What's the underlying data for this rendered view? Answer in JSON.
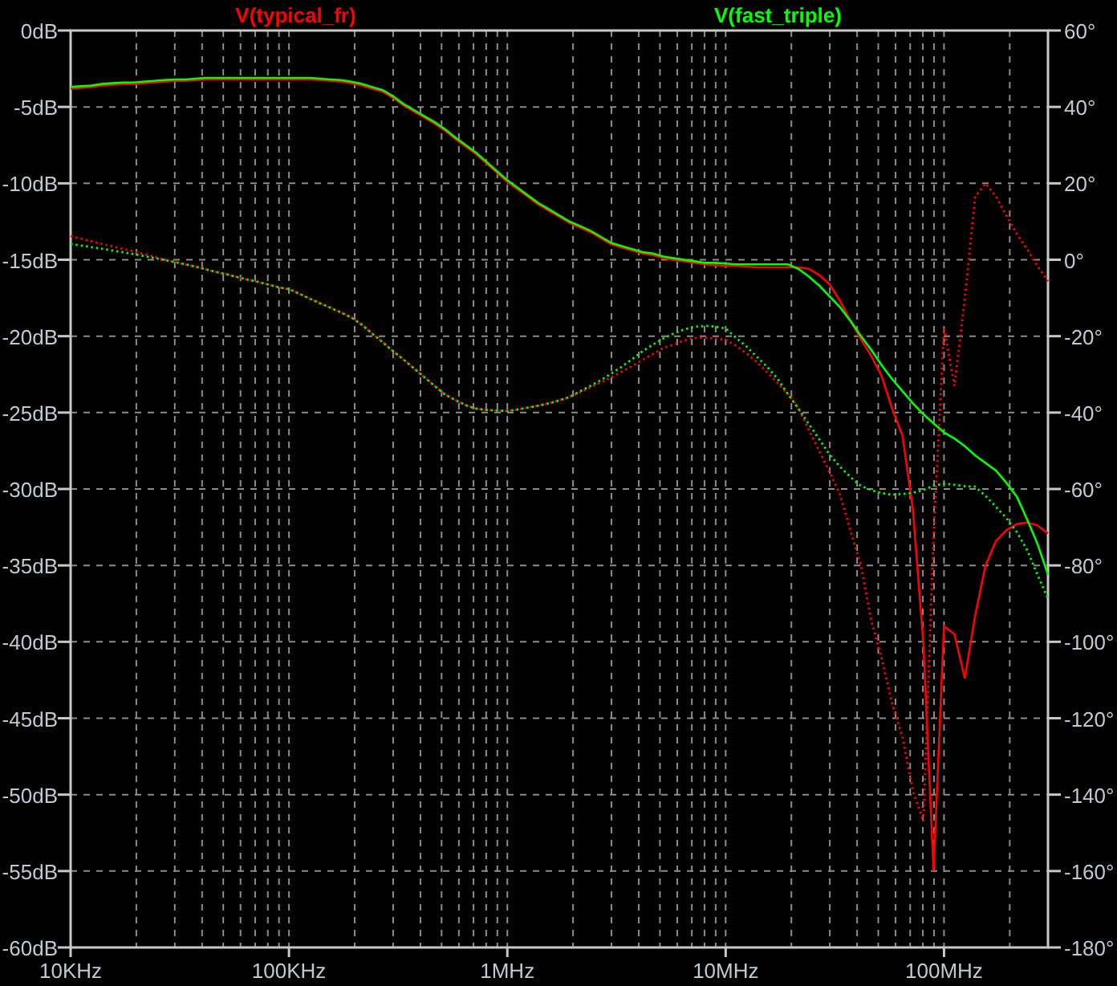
{
  "plot": {
    "magnitude": {
      "chart_data": {
        "type": "line",
        "grid": true,
        "categories": [
          "10KHz",
          null,
          null,
          null,
          null,
          null,
          null,
          null,
          null,
          null,
          null,
          null,
          null,
          null,
          null,
          null,
          null,
          null,
          null,
          null,
          null,
          "100KHz",
          null,
          null,
          null,
          null,
          null,
          null,
          null,
          null,
          null,
          null,
          null,
          null,
          null,
          null,
          null,
          null,
          null,
          null,
          null,
          null,
          "1MHz",
          null,
          null,
          null,
          null,
          null,
          null,
          null,
          null,
          null,
          null,
          null,
          null,
          null,
          null,
          null,
          null,
          null,
          null,
          null,
          null,
          "10MHz",
          null,
          null,
          null,
          null,
          null,
          null,
          null,
          null,
          null,
          null,
          null,
          null,
          null,
          null,
          null,
          null,
          null,
          null,
          null,
          null,
          "100MHz",
          null,
          null,
          null,
          null,
          null,
          null,
          null,
          null,
          null,
          null
        ],
        "ylim": [
          -60,
          0
        ],
        "yticks": [
          {
            "value": 0,
            "label": "0dB"
          },
          {
            "value": -5,
            "label": "-5dB"
          },
          {
            "value": -10,
            "label": "-10dB"
          },
          {
            "value": -15,
            "label": "-15dB"
          },
          {
            "value": -20,
            "label": "-20dB"
          },
          {
            "value": -25,
            "label": "-25dB"
          },
          {
            "value": -30,
            "label": "-30dB"
          },
          {
            "value": -35,
            "label": "-35dB"
          },
          {
            "value": -40,
            "label": "-40dB"
          },
          {
            "value": -45,
            "label": "-45dB"
          },
          {
            "value": -50,
            "label": "-50dB"
          },
          {
            "value": -55,
            "label": "-55dB"
          },
          {
            "value": -60,
            "label": "-60dB"
          }
        ],
        "series": [
          {
            "name": "V(typical_fr)",
            "color": "#ff0000",
            "line_style": "solid",
            "values": [
              -3.8,
              -3.75,
              -3.7,
              -3.6,
              -3.55,
              -3.5,
              -3.5,
              -3.45,
              -3.4,
              -3.35,
              -3.3,
              -3.3,
              -3.25,
              -3.2,
              -3.2,
              -3.2,
              -3.2,
              -3.2,
              -3.2,
              -3.2,
              -3.2,
              -3.2,
              -3.2,
              -3.2,
              -3.25,
              -3.3,
              -3.35,
              -3.45,
              -3.6,
              -3.8,
              -4.0,
              -4.4,
              -4.9,
              -5.3,
              -5.7,
              -6.1,
              -6.55,
              -7.1,
              -7.6,
              -8.1,
              -8.7,
              -9.3,
              -9.9,
              -10.4,
              -10.9,
              -11.4,
              -11.8,
              -12.2,
              -12.6,
              -12.9,
              -13.2,
              -13.6,
              -14.0,
              -14.2,
              -14.4,
              -14.6,
              -14.7,
              -14.9,
              -15.0,
              -15.1,
              -15.2,
              -15.3,
              -15.35,
              -15.4,
              -15.4,
              -15.45,
              -15.5,
              -15.5,
              -15.5,
              -15.5,
              -15.5,
              -15.6,
              -16.0,
              -16.6,
              -17.7,
              -19.0,
              -20.2,
              -21.3,
              -22.6,
              -24.7,
              -26.5,
              -31.3,
              -40.0,
              -55.0,
              -39.0,
              -39.5,
              -42.4,
              -38.3,
              -35.0,
              -33.4,
              -32.7,
              -32.3,
              -32.2,
              -32.4,
              -32.9
            ]
          },
          {
            "name": "V(fast_triple)",
            "color": "#00ff00",
            "line_style": "solid",
            "values": [
              -3.7,
              -3.65,
              -3.6,
              -3.5,
              -3.45,
              -3.4,
              -3.4,
              -3.35,
              -3.3,
              -3.25,
              -3.2,
              -3.2,
              -3.15,
              -3.1,
              -3.1,
              -3.1,
              -3.1,
              -3.1,
              -3.1,
              -3.1,
              -3.1,
              -3.1,
              -3.1,
              -3.1,
              -3.15,
              -3.2,
              -3.25,
              -3.35,
              -3.5,
              -3.7,
              -3.9,
              -4.3,
              -4.8,
              -5.2,
              -5.6,
              -6.0,
              -6.45,
              -7.0,
              -7.5,
              -8.0,
              -8.6,
              -9.2,
              -9.8,
              -10.3,
              -10.8,
              -11.3,
              -11.7,
              -12.1,
              -12.5,
              -12.8,
              -13.1,
              -13.5,
              -13.9,
              -14.1,
              -14.3,
              -14.5,
              -14.6,
              -14.8,
              -14.9,
              -15.0,
              -15.1,
              -15.2,
              -15.2,
              -15.25,
              -15.3,
              -15.3,
              -15.3,
              -15.3,
              -15.3,
              -15.3,
              -15.6,
              -16.1,
              -16.7,
              -17.4,
              -18.1,
              -19.0,
              -20.0,
              -20.9,
              -21.9,
              -22.8,
              -23.6,
              -24.4,
              -25.1,
              -25.7,
              -26.3,
              -26.7,
              -27.2,
              -27.8,
              -28.3,
              -28.8,
              -29.6,
              -30.5,
              -32.0,
              -33.6,
              -35.6
            ]
          }
        ]
      }
    },
    "phase": {
      "chart_data": {
        "type": "line",
        "categories": [
          null,
          null,
          null,
          null,
          null,
          null,
          null,
          null,
          null,
          null,
          null,
          null,
          null,
          null,
          null,
          null,
          null,
          null,
          null,
          null,
          null,
          null,
          null,
          null,
          null,
          null,
          null,
          null,
          null,
          null,
          null,
          null,
          null,
          null,
          null,
          null,
          null,
          null,
          null,
          null,
          null,
          null,
          null,
          null,
          null,
          null,
          null,
          null,
          null,
          null,
          null,
          null,
          null,
          null,
          null,
          null,
          null,
          null,
          null,
          null,
          null,
          null,
          null,
          null,
          null,
          null,
          null,
          null,
          null,
          null,
          null,
          null,
          null,
          null,
          null,
          null,
          null,
          null,
          null,
          null,
          null,
          null,
          null,
          null,
          null,
          null,
          null,
          null,
          null,
          null,
          null,
          null,
          null,
          null,
          null
        ],
        "ylim": [
          -180,
          60
        ],
        "yticks": [
          {
            "value": 60,
            "label": "60°"
          },
          {
            "value": 40,
            "label": "40°"
          },
          {
            "value": 20,
            "label": "20°"
          },
          {
            "value": 0,
            "label": "0°"
          },
          {
            "value": -20,
            "label": "-20°"
          },
          {
            "value": -40,
            "label": "-40°"
          },
          {
            "value": -60,
            "label": "-60°"
          },
          {
            "value": -80,
            "label": "-80°"
          },
          {
            "value": -100,
            "label": "-100°"
          },
          {
            "value": -120,
            "label": "-120°"
          },
          {
            "value": -140,
            "label": "-140°"
          },
          {
            "value": -160,
            "label": "-160°"
          },
          {
            "value": -180,
            "label": "-180°"
          }
        ],
        "series": [
          {
            "color": "#ff0000",
            "line_style": "dotted",
            "values": [
              6.2,
              5.5,
              4.8,
              4.2,
              3.5,
              2.9,
              2.2,
              1.5,
              0.8,
              0,
              -0.6,
              -1.2,
              -1.8,
              -2.5,
              -3.2,
              -3.8,
              -4.5,
              -5.2,
              -5.8,
              -6.5,
              -7.2,
              -7.7,
              -8.9,
              -10.2,
              -11.4,
              -12.6,
              -13.8,
              -15.1,
              -17,
              -19.3,
              -21.6,
              -23.9,
              -26.1,
              -28.4,
              -30.7,
              -33,
              -35.3,
              -36.7,
              -38.1,
              -39,
              -39.3,
              -39.5,
              -39.6,
              -39.2,
              -38.7,
              -38.2,
              -37.6,
              -36.8,
              -35.9,
              -34.7,
              -33.4,
              -32.1,
              -30.8,
              -29.3,
              -27.8,
              -26.2,
              -24.7,
              -23.1,
              -22.2,
              -21.1,
              -20.5,
              -20.4,
              -20.6,
              -21,
              -22.5,
              -24.5,
              -26.8,
              -29.5,
              -32.3,
              -35.2,
              -38.9,
              -44.6,
              -50.1,
              -55.6,
              -61.5,
              -70.9,
              -80,
              -94.5,
              -104.2,
              -116.1,
              -124.9,
              -139,
              -147,
              -72,
              -18,
              -33,
              -10,
              16.5,
              20,
              16.5,
              11.5,
              6.7,
              2.7,
              -1.7,
              -5.6
            ]
          },
          {
            "color": "#00ff00",
            "line_style": "dotted",
            "values": [
              4.1,
              3.7,
              3.3,
              2.9,
              2.4,
              2,
              1.5,
              1,
              0.5,
              0,
              -0.6,
              -1.2,
              -1.8,
              -2.5,
              -3.2,
              -3.8,
              -4.5,
              -5.2,
              -5.8,
              -6.5,
              -7.2,
              -7.7,
              -8.9,
              -10.2,
              -11.4,
              -12.6,
              -13.8,
              -15.1,
              -17,
              -19.3,
              -21.6,
              -23.9,
              -26.1,
              -28.4,
              -30.7,
              -33,
              -35.3,
              -36.7,
              -38.1,
              -39,
              -39.3,
              -39.5,
              -39.6,
              -39.2,
              -38.7,
              -38.2,
              -37.6,
              -36.8,
              -35.9,
              -34.4,
              -33,
              -31.5,
              -29.8,
              -28,
              -26,
              -24,
              -22.2,
              -20.6,
              -19.3,
              -18.2,
              -17.6,
              -17.3,
              -17.5,
              -18,
              -20.4,
              -22.7,
              -25.4,
              -28.1,
              -31.2,
              -35.2,
              -39,
              -43,
              -47,
              -51,
              -54.2,
              -56.9,
              -59.2,
              -60.3,
              -61.1,
              -61.5,
              -61.3,
              -61,
              -60.3,
              -59.1,
              -58.6,
              -58.9,
              -59.3,
              -59.4,
              -61.8,
              -64.7,
              -67.6,
              -71.3,
              -76,
              -82.5,
              -88.8
            ]
          }
        ]
      }
    }
  }
}
